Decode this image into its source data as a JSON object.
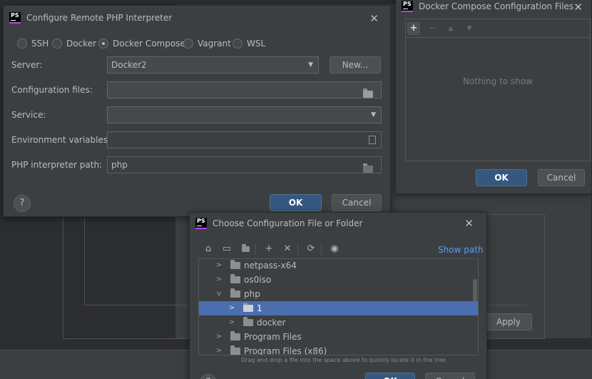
{
  "remote_dialog": {
    "title": "Configure Remote PHP Interpreter",
    "close": "✕",
    "radios": [
      {
        "label": "SSH",
        "selected": false
      },
      {
        "label": "Docker",
        "selected": false
      },
      {
        "label": "Docker Compose",
        "selected": true
      },
      {
        "label": "Vagrant",
        "selected": false
      },
      {
        "label": "WSL",
        "selected": false
      }
    ],
    "server_label": "Server:",
    "server_value": "Docker2",
    "new_button": "New...",
    "config_label": "Configuration files:",
    "config_value": "",
    "service_label": "Service:",
    "service_value": "",
    "env_label": "Environment variables:",
    "env_value": "",
    "php_label": "PHP interpreter path:",
    "php_value": "php",
    "help": "?",
    "ok": "OK",
    "cancel": "Cancel"
  },
  "compose_dialog": {
    "title": "Docker Compose Configuration Files",
    "close": "✕",
    "empty_text": "Nothing to show",
    "ok": "OK",
    "cancel": "Cancel"
  },
  "background": {
    "apply": "Apply"
  },
  "chooser": {
    "title": "Choose Configuration File or Folder",
    "close": "✕",
    "show_path": "Show path",
    "hint": "Drag and drop a file into the space above to quickly locate it in the tree",
    "tree": [
      {
        "label": "netpass-x64",
        "depth": 0,
        "expanded": false,
        "selected": false
      },
      {
        "label": "os0iso",
        "depth": 0,
        "expanded": false,
        "selected": false
      },
      {
        "label": "php",
        "depth": 0,
        "expanded": true,
        "selected": false
      },
      {
        "label": "1",
        "depth": 1,
        "expanded": false,
        "selected": true
      },
      {
        "label": "docker",
        "depth": 1,
        "expanded": false,
        "selected": false
      },
      {
        "label": "Program Files",
        "depth": 0,
        "expanded": false,
        "selected": false
      },
      {
        "label": "Program Files (x86)",
        "depth": 0,
        "expanded": false,
        "selected": false
      }
    ],
    "ok": "OK",
    "cancel": "Cancel"
  },
  "colors": {
    "accent": "#4b6eaf",
    "primary_button": "#365880",
    "link": "#589df6",
    "panel": "#3c3f41"
  }
}
